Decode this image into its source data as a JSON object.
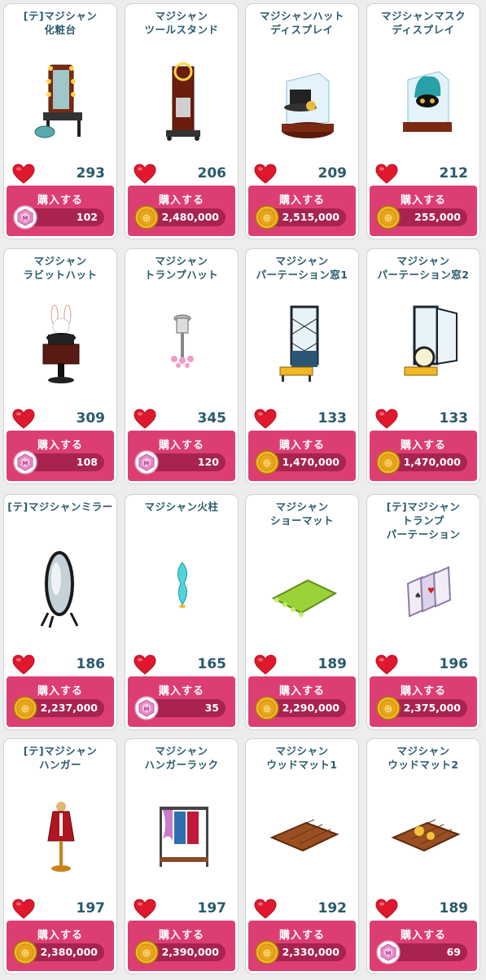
{
  "buy_label": "購入する",
  "items": [
    {
      "name1": "[テ]マジシャン",
      "name2": "化粧台",
      "likes": "293",
      "currency": "gem",
      "price": "102",
      "icon": "vanity-table-icon"
    },
    {
      "name1": "マジシャン",
      "name2": "ツールスタンド",
      "likes": "206",
      "currency": "coin",
      "price": "2,480,000",
      "icon": "tool-stand-icon"
    },
    {
      "name1": "マジシャンハット",
      "name2": "ディスプレイ",
      "likes": "209",
      "currency": "coin",
      "price": "2,515,000",
      "icon": "hat-display-icon"
    },
    {
      "name1": "マジシャンマスク",
      "name2": "ディスプレイ",
      "likes": "212",
      "currency": "coin",
      "price": "255,000",
      "icon": "mask-display-icon"
    },
    {
      "name1": "マジシャン",
      "name2": "ラビットハット",
      "likes": "309",
      "currency": "gem",
      "price": "108",
      "icon": "rabbit-hat-icon"
    },
    {
      "name1": "マジシャン",
      "name2": "トランプハット",
      "likes": "345",
      "currency": "gem",
      "price": "120",
      "icon": "card-hat-icon"
    },
    {
      "name1": "マジシャン",
      "name2": "パーテーション窓1",
      "likes": "133",
      "currency": "coin",
      "price": "1,470,000",
      "icon": "partition-window-icon"
    },
    {
      "name1": "マジシャン",
      "name2": "パーテーション窓2",
      "likes": "133",
      "currency": "coin",
      "price": "1,470,000",
      "icon": "partition-window-2-icon"
    },
    {
      "name1": "[テ]マジシャンミラー",
      "name2": "",
      "likes": "186",
      "currency": "coin",
      "price": "2,237,000",
      "icon": "mirror-icon"
    },
    {
      "name1": "マジシャン火柱",
      "name2": "",
      "likes": "165",
      "currency": "gem",
      "price": "35",
      "icon": "fire-pillar-icon"
    },
    {
      "name1": "マジシャン",
      "name2": "ショーマット",
      "likes": "189",
      "currency": "coin",
      "price": "2,290,000",
      "icon": "show-mat-icon"
    },
    {
      "name1": "[テ]マジシャン",
      "name2": "トランプ",
      "name3": "パーテーション",
      "likes": "196",
      "currency": "coin",
      "price": "2,375,000",
      "icon": "card-partition-icon"
    },
    {
      "name1": "[テ]マジシャン",
      "name2": "ハンガー",
      "likes": "197",
      "currency": "coin",
      "price": "2,380,000",
      "icon": "hanger-icon"
    },
    {
      "name1": "マジシャン",
      "name2": "ハンガーラック",
      "likes": "197",
      "currency": "coin",
      "price": "2,390,000",
      "icon": "hanger-rack-icon"
    },
    {
      "name1": "マジシャン",
      "name2": "ウッドマット1",
      "likes": "192",
      "currency": "coin",
      "price": "2,330,000",
      "icon": "wood-mat-icon"
    },
    {
      "name1": "マジシャン",
      "name2": "ウッドマット2",
      "likes": "189",
      "currency": "gem",
      "price": "69",
      "icon": "wood-mat-2-icon"
    }
  ],
  "colors": {
    "accent": "#dd3e72",
    "price_bar": "#a8234f",
    "text": "#2a5a6c",
    "heart": "#e0182d",
    "coin": "#e8a51c",
    "gem": "#e48ac6"
  }
}
